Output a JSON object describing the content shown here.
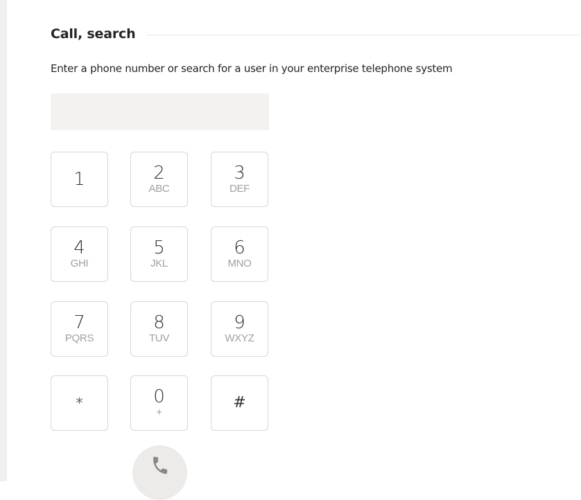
{
  "section": {
    "title": "Call, search",
    "description": "Enter a phone number or search for a user in your enterprise telephone system"
  },
  "search": {
    "value": "",
    "placeholder": ""
  },
  "dialpad": {
    "keys": [
      {
        "digit": "1",
        "letters": ""
      },
      {
        "digit": "2",
        "letters": "ABC"
      },
      {
        "digit": "3",
        "letters": "DEF"
      },
      {
        "digit": "4",
        "letters": "GHI"
      },
      {
        "digit": "5",
        "letters": "JKL"
      },
      {
        "digit": "6",
        "letters": "MNO"
      },
      {
        "digit": "7",
        "letters": "PQRS"
      },
      {
        "digit": "8",
        "letters": "TUV"
      },
      {
        "digit": "9",
        "letters": "WXYZ"
      },
      {
        "digit": "*",
        "letters": ""
      },
      {
        "digit": "0",
        "letters": "+"
      },
      {
        "digit": "#",
        "letters": ""
      }
    ]
  },
  "call_button": {
    "icon": "phone-icon"
  },
  "colors": {
    "key_border": "#d6d6d6",
    "letters": "#a19f9d",
    "input_background": "#f3f2f1",
    "call_button_background": "#edebe9",
    "phone_icon": "#8a8886"
  }
}
